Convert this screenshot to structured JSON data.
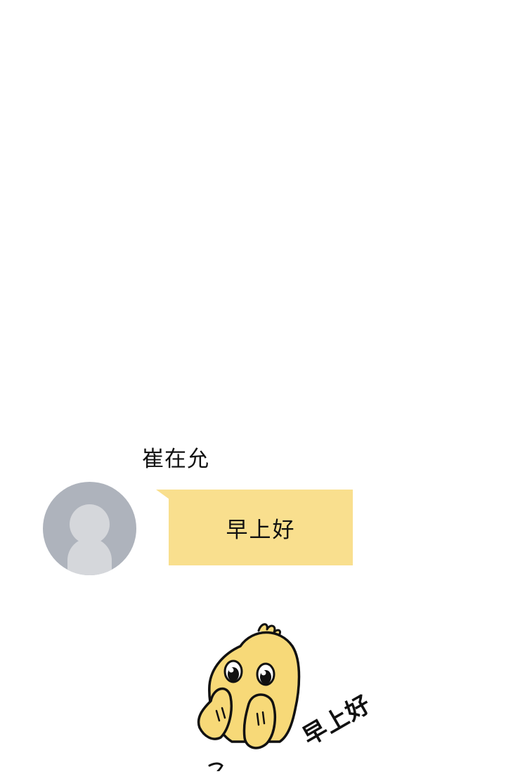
{
  "chat": {
    "sender_name": "崔在允",
    "message": "早上好",
    "sticker_text": "早上好"
  },
  "colors": {
    "background": "#ffffff",
    "bubble": "#f9df8e",
    "avatar_bg": "#aeb3bc",
    "avatar_figure": "#d5d7db",
    "sticker_fill": "#f7d978"
  },
  "icons": {
    "avatar": "default-user-avatar-icon",
    "sticker": "yellow-chick-sticker"
  }
}
